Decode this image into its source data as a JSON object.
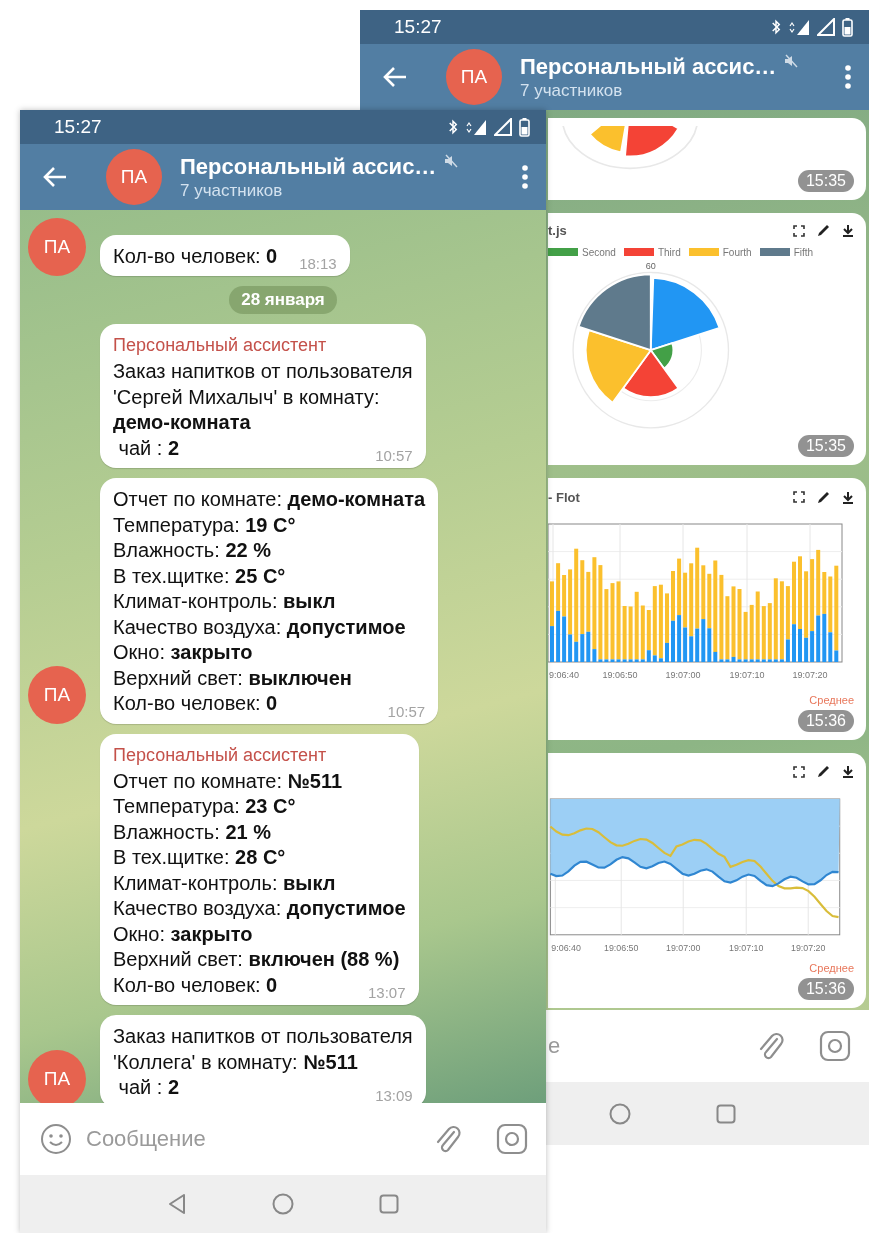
{
  "back_screen": {
    "status_bar": {
      "time": "15:27"
    },
    "header": {
      "avatar": "ПА",
      "title": "Персональный ассис…",
      "subtitle": "7 участников",
      "muted": true
    },
    "cards": [
      {
        "kind": "pie-fragment",
        "time": "15:35"
      },
      {
        "kind": "polar",
        "title": "t.js",
        "legend": [
          {
            "label": "Second",
            "color": "#43a047"
          },
          {
            "label": "Third",
            "color": "#f44336"
          },
          {
            "label": "Fourth",
            "color": "#fbc02d"
          },
          {
            "label": "Fifth",
            "color": "#5f7a8c"
          }
        ],
        "tick": "60",
        "time": "15:35"
      },
      {
        "kind": "bars",
        "title": "- Flot",
        "xticks": [
          "9:06:40",
          "19:06:50",
          "19:07:00",
          "19:07:10",
          "19:07:20"
        ],
        "legend_title": "Среднее",
        "time": "15:36"
      },
      {
        "kind": "lines",
        "xticks": [
          "9:06:40",
          "19:06:50",
          "19:07:00",
          "19:07:10",
          "19:07:20"
        ],
        "legend_title": "Среднее",
        "time": "15:36"
      }
    ],
    "composer": {
      "placeholder": "е",
      "emoji": false
    },
    "nav": {
      "back_button": false
    }
  },
  "front_screen": {
    "status_bar": {
      "time": "15:27"
    },
    "header": {
      "avatar": "ПА",
      "title": "Персональный ассис…",
      "subtitle": "7 участников",
      "muted": true
    },
    "chat": [
      {
        "kind": "message",
        "avatar": "ПА",
        "lines": [
          "Кол-во человек: **0**"
        ],
        "time": "18:13"
      },
      {
        "kind": "date",
        "text": "28 января"
      },
      {
        "kind": "message",
        "sender": "Персональный ассистент",
        "lines": [
          "Заказ напитков от пользователя",
          "'Сергей Михалыч' в комнату:",
          "**демо-комната**",
          " чай : **2**"
        ],
        "time": "10:57"
      },
      {
        "kind": "message",
        "avatar": "ПА",
        "lines": [
          "Отчет по комнате: **демо-комната**",
          "Температура: **19 C°**",
          "Влажность: **22 %**",
          "В тех.щитке: **25 C°**",
          "Климат-контроль: **выкл**",
          "Качество воздуха: **допустимое**",
          "Окно: **закрыто**",
          "Верхний свет: **выключен**",
          "Кол-во человек: **0**"
        ],
        "time": "10:57"
      },
      {
        "kind": "message",
        "sender": "Персональный ассистент",
        "lines": [
          "Отчет по комнате: **№511**",
          "Температура: **23 C°**",
          "Влажность: **21 %**",
          "В тех.щитке: **28 C°**",
          "Климат-контроль: **выкл**",
          "Качество воздуха: **допустимое**",
          "Окно: **закрыто**",
          "Верхний свет: **включен (88 %)**",
          "Кол-во человек: **0**"
        ],
        "time": "13:07"
      },
      {
        "kind": "message",
        "avatar": "ПА",
        "lines": [
          "Заказ напитков от пользователя",
          "'Коллега' в комнату: **№511**",
          " чай : **2**"
        ],
        "time": "13:09"
      }
    ],
    "composer": {
      "placeholder": "Сообщение",
      "emoji": true
    },
    "nav": {
      "back_button": true
    }
  }
}
